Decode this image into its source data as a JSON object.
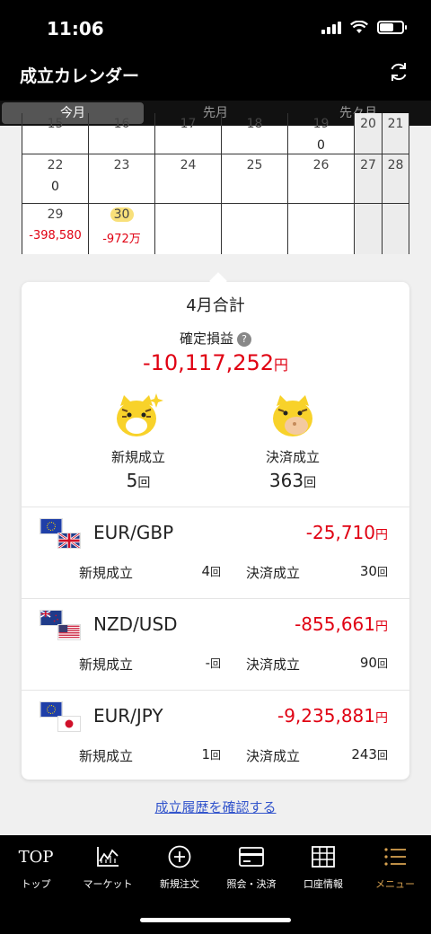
{
  "status_bar": {
    "time": "11:06"
  },
  "header": {
    "title": "成立カレンダー"
  },
  "tabs": [
    "今月",
    "先月",
    "先々月"
  ],
  "calendar": {
    "rows": [
      [
        {
          "d": "15",
          "v": ""
        },
        {
          "d": "16",
          "v": ""
        },
        {
          "d": "17",
          "v": ""
        },
        {
          "d": "18",
          "v": ""
        },
        {
          "d": "19",
          "v": "0"
        },
        {
          "d": "20",
          "v": ""
        },
        {
          "d": "21",
          "v": ""
        }
      ],
      [
        {
          "d": "22",
          "v": "0"
        },
        {
          "d": "23",
          "v": ""
        },
        {
          "d": "24",
          "v": ""
        },
        {
          "d": "25",
          "v": ""
        },
        {
          "d": "26",
          "v": ""
        },
        {
          "d": "27",
          "v": ""
        },
        {
          "d": "28",
          "v": ""
        }
      ],
      [
        {
          "d": "29",
          "v": "-398,580"
        },
        {
          "d": "30",
          "v": "-972万"
        },
        {
          "d": "",
          "v": ""
        },
        {
          "d": "",
          "v": ""
        },
        {
          "d": "",
          "v": ""
        },
        {
          "d": "",
          "v": ""
        },
        {
          "d": "",
          "v": ""
        }
      ]
    ]
  },
  "summary": {
    "title": "4月合計",
    "pl_label": "確定損益",
    "help": "?",
    "pl_value": "-10,117,252",
    "yen": "円",
    "new_label": "新規成立",
    "new_value": "5",
    "close_label": "決済成立",
    "close_value": "363",
    "count_unit": "回"
  },
  "pairs": [
    {
      "name": "EUR/GBP",
      "pl": "-25,710",
      "new": "4",
      "close": "30"
    },
    {
      "name": "NZD/USD",
      "pl": "-855,661",
      "new": "-",
      "close": "90"
    },
    {
      "name": "EUR/JPY",
      "pl": "-9,235,881",
      "new": "1",
      "close": "243"
    }
  ],
  "pair_labels": {
    "new": "新規成立",
    "close": "決済成立",
    "unit": "回",
    "yen": "円"
  },
  "history_link": "成立履歴を確認する",
  "nav": {
    "top_icon": "TOP",
    "items": [
      "トップ",
      "マーケット",
      "新規注文",
      "照会・決済",
      "口座情報",
      "メニュー"
    ]
  },
  "colors": {
    "negative": "#e00012",
    "accent": "#d8a250",
    "today_highlight": "#f8e07a"
  }
}
